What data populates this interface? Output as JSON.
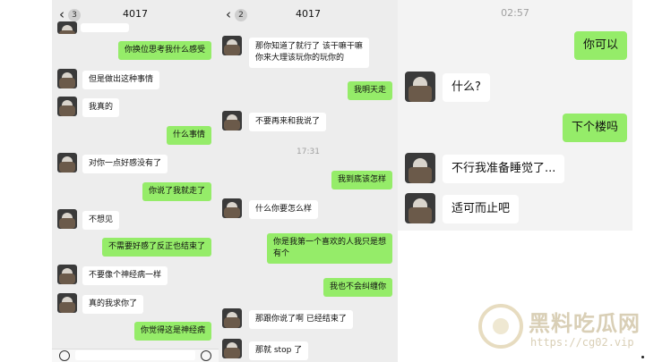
{
  "panel1": {
    "back_glyph": "‹",
    "badge": "3",
    "title": "4017",
    "messages": [
      {
        "side": "out",
        "text": "你换位思考我什么感受"
      },
      {
        "side": "in",
        "text": "但是做出这种事情"
      },
      {
        "side": "in",
        "text": "我真的"
      },
      {
        "side": "out",
        "text": "什么事情"
      },
      {
        "side": "in",
        "text": "对你一点好感没有了"
      },
      {
        "side": "out",
        "text": "你说了我就走了"
      },
      {
        "side": "in",
        "text": "不想见"
      },
      {
        "side": "out",
        "text": "不需要好感了反正也结束了"
      },
      {
        "side": "in",
        "text": "不要像个神经病一样"
      },
      {
        "side": "in",
        "text": "真的我求你了"
      },
      {
        "side": "out",
        "text": "你觉得这是神经病"
      }
    ]
  },
  "panel2": {
    "back_glyph": "‹",
    "badge": "2",
    "title": "4017",
    "timestamp": "17:31",
    "messages": [
      {
        "side": "in",
        "text": "那你知道了就行了 该干嘛干嘛\n你来大理该玩你的玩你的"
      },
      {
        "side": "out",
        "text": "我明天走"
      },
      {
        "side": "in",
        "text": "不要再来和我说了"
      },
      {
        "side": "out",
        "text": "我到底该怎样"
      },
      {
        "side": "in",
        "text": "什么你要怎么样"
      },
      {
        "side": "out",
        "text": "你是我第一个喜欢的人我只是想\n有个"
      },
      {
        "side": "out",
        "text": "我也不会纠缠你"
      },
      {
        "side": "in",
        "text": "那跟你说了啊 已经结束了"
      },
      {
        "side": "in",
        "text": "那就 stop 了"
      }
    ]
  },
  "panel3": {
    "timestamp": "02:57",
    "messages": [
      {
        "side": "out",
        "text": "你可以"
      },
      {
        "side": "in",
        "text": "什么?"
      },
      {
        "side": "out",
        "text": "下个楼吗"
      },
      {
        "side": "in",
        "text": "不行我准备睡觉了..."
      },
      {
        "side": "in",
        "text": "适可而止吧"
      }
    ]
  },
  "watermark": {
    "title": "黑料吃瓜网",
    "url": "https://cg02.vip"
  }
}
